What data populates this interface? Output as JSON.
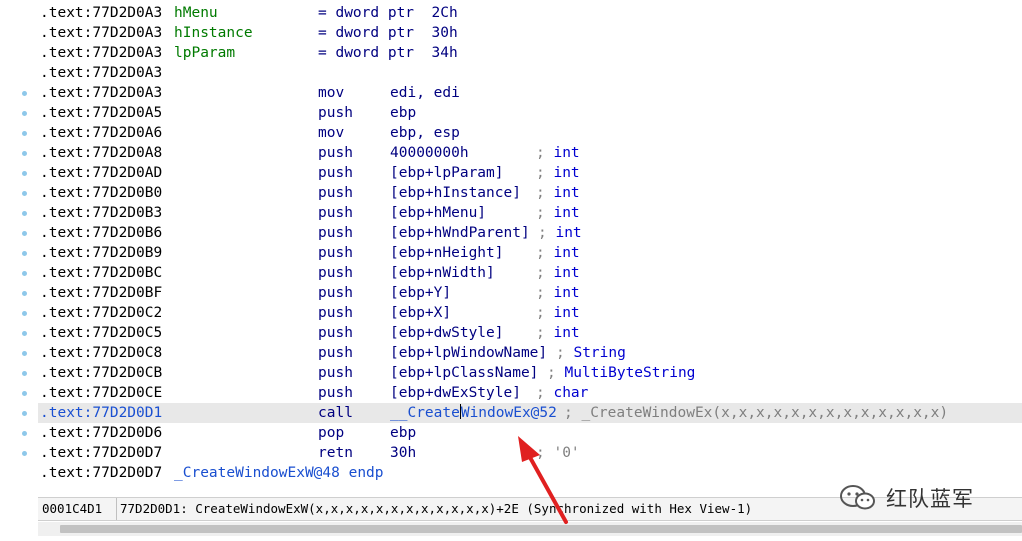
{
  "listing": {
    "rows": [
      {
        "addr": ".text:77D2D0A3",
        "label": "hMenu",
        "mn": "= dword ptr  2Ch",
        "op": "",
        "comment": "",
        "dot": false
      },
      {
        "addr": ".text:77D2D0A3",
        "label": "hInstance",
        "mn": "= dword ptr  30h",
        "op": "",
        "comment": "",
        "dot": false
      },
      {
        "addr": ".text:77D2D0A3",
        "label": "lpParam",
        "mn": "= dword ptr  34h",
        "op": "",
        "comment": "",
        "dot": false
      },
      {
        "addr": ".text:77D2D0A3",
        "label": "",
        "mn": "",
        "op": "",
        "comment": "",
        "dot": false
      },
      {
        "addr": ".text:77D2D0A3",
        "label": "",
        "mn": "mov",
        "op": "edi, edi",
        "comment": "",
        "dot": true
      },
      {
        "addr": ".text:77D2D0A5",
        "label": "",
        "mn": "push",
        "op": "ebp",
        "comment": "",
        "dot": true
      },
      {
        "addr": ".text:77D2D0A6",
        "label": "",
        "mn": "mov",
        "op": "ebp, esp",
        "comment": "",
        "dot": true
      },
      {
        "addr": ".text:77D2D0A8",
        "label": "",
        "mn": "push",
        "op": "40000000h",
        "comment": "; int",
        "dot": true
      },
      {
        "addr": ".text:77D2D0AD",
        "label": "",
        "mn": "push",
        "op": "[ebp+lpParam]",
        "comment": "; int",
        "dot": true
      },
      {
        "addr": ".text:77D2D0B0",
        "label": "",
        "mn": "push",
        "op": "[ebp+hInstance]",
        "comment": "; int",
        "dot": true
      },
      {
        "addr": ".text:77D2D0B3",
        "label": "",
        "mn": "push",
        "op": "[ebp+hMenu]",
        "comment": "; int",
        "dot": true
      },
      {
        "addr": ".text:77D2D0B6",
        "label": "",
        "mn": "push",
        "op": "[ebp+hWndParent]",
        "comment": "; int",
        "dot": true
      },
      {
        "addr": ".text:77D2D0B9",
        "label": "",
        "mn": "push",
        "op": "[ebp+nHeight]",
        "comment": "; int",
        "dot": true
      },
      {
        "addr": ".text:77D2D0BC",
        "label": "",
        "mn": "push",
        "op": "[ebp+nWidth]",
        "comment": "; int",
        "dot": true
      },
      {
        "addr": ".text:77D2D0BF",
        "label": "",
        "mn": "push",
        "op": "[ebp+Y]",
        "comment": "; int",
        "dot": true
      },
      {
        "addr": ".text:77D2D0C2",
        "label": "",
        "mn": "push",
        "op": "[ebp+X]",
        "comment": "; int",
        "dot": true
      },
      {
        "addr": ".text:77D2D0C5",
        "label": "",
        "mn": "push",
        "op": "[ebp+dwStyle]",
        "comment": "; int",
        "dot": true
      },
      {
        "addr": ".text:77D2D0C8",
        "label": "",
        "mn": "push",
        "op": "[ebp+lpWindowName]",
        "comment": "; String",
        "dot": true
      },
      {
        "addr": ".text:77D2D0CB",
        "label": "",
        "mn": "push",
        "op": "[ebp+lpClassName]",
        "comment": "; MultiByteString",
        "dot": true
      },
      {
        "addr": ".text:77D2D0CE",
        "label": "",
        "mn": "push",
        "op": "[ebp+dwExStyle]",
        "comment": "; char",
        "dot": true
      },
      {
        "addr": ".text:77D2D0D1",
        "label": "",
        "mn": "call",
        "op_a": "__Create",
        "op_b": "WindowEx@52",
        "comment": "; _CreateWindowEx(x,x,x,x,x,x,x,x,x,x,x,x,x)",
        "dot": true,
        "selected": true
      },
      {
        "addr": ".text:77D2D0D6",
        "label": "",
        "mn": "pop",
        "op": "ebp",
        "comment": "",
        "dot": true
      },
      {
        "addr": ".text:77D2D0D7",
        "label": "",
        "mn": "retn",
        "op": "30h",
        "comment": "; '0'",
        "dot": true
      },
      {
        "addr": ".text:77D2D0D7",
        "label": "_CreateWindowExW@48 endp",
        "mn": "",
        "op": "",
        "comment": "",
        "dot": false
      }
    ]
  },
  "status": {
    "offset": "0001C4D1",
    "text": "77D2D0D1: CreateWindowExW(x,x,x,x,x,x,x,x,x,x,x,x)+2E (Synchronized with Hex View-1)"
  },
  "watermark": {
    "text": "红队蓝军",
    "icon": "wechat-icon"
  },
  "colors": {
    "address": "#000000",
    "label": "#007a00",
    "mnemonic": "#000080",
    "comment": "#7f7f7f",
    "selection": "#e8e8e8",
    "arrow": "#e02020"
  }
}
